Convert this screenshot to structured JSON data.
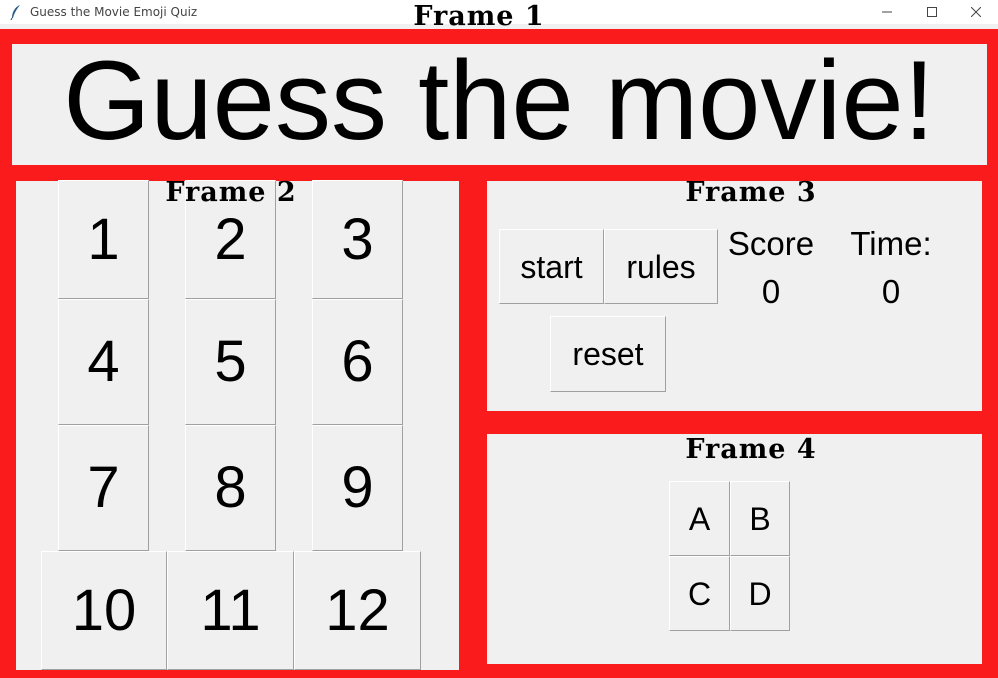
{
  "window": {
    "title": "Guess the Movie Emoji Quiz"
  },
  "colors": {
    "frame_border": "#fa1c1c",
    "background": "#f0f0f0"
  },
  "frames": {
    "f1": "Frame 1",
    "f2": "Frame 2",
    "f3": "Frame 3",
    "f4": "Frame 4"
  },
  "heading": "Guess the movie!",
  "number_buttons": [
    "1",
    "2",
    "3",
    "4",
    "5",
    "6",
    "7",
    "8",
    "9",
    "10",
    "11",
    "12"
  ],
  "controls": {
    "start": "start",
    "rules": "rules",
    "reset": "reset"
  },
  "score": {
    "label": "Score",
    "value": "0"
  },
  "time": {
    "label": "Time:",
    "value": "0"
  },
  "options": [
    "A",
    "B",
    "C",
    "D"
  ]
}
